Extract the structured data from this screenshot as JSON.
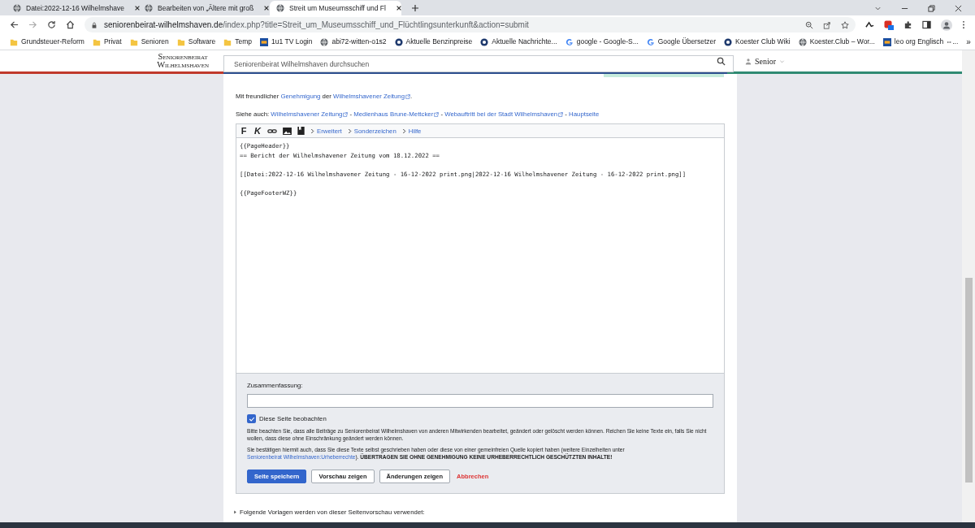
{
  "browser": {
    "tabs": [
      {
        "title": "Datei:2022-12-16 Wilhelmshave",
        "selected": false
      },
      {
        "title": "Bearbeiten von „Ältere mit groß",
        "selected": false
      },
      {
        "title": "Streit um Museumsschiff und Fl",
        "selected": true
      }
    ],
    "address": {
      "host": "seniorenbeirat-wilhelmshaven.de",
      "path": "/index.php?title=Streit_um_Museumsschiff_und_Flüchtlingsunterkunft&action=submit"
    },
    "bookmarks": [
      {
        "label": "Grundsteuer-Reform",
        "kind": "folder"
      },
      {
        "label": "Privat",
        "kind": "folder"
      },
      {
        "label": "Senioren",
        "kind": "folder"
      },
      {
        "label": "Software",
        "kind": "folder"
      },
      {
        "label": "Temp",
        "kind": "folder"
      },
      {
        "label": "1u1 TV Login",
        "kind": "badge"
      },
      {
        "label": "abi72-witten-o1s2",
        "kind": "globe"
      },
      {
        "label": "Aktuelle Benzinpreise",
        "kind": "site"
      },
      {
        "label": "Aktuelle Nachrichte...",
        "kind": "site"
      },
      {
        "label": "google - Google-S...",
        "kind": "google"
      },
      {
        "label": "Google Übersetzer",
        "kind": "google"
      },
      {
        "label": "Koester Club Wiki",
        "kind": "site"
      },
      {
        "label": "Koester.Club – Wor...",
        "kind": "globe"
      },
      {
        "label": "leo org  Englisch ⇔...",
        "kind": "badge"
      }
    ],
    "more": "»"
  },
  "site": {
    "logo_lines": [
      "Seniorenbeirat",
      "Wilhelmshaven"
    ],
    "search_placeholder": "Seniorenbeirat Wilhelmshaven durchsuchen",
    "user": "Senior"
  },
  "content": {
    "credit": [
      {
        "kind": "text",
        "text": "Mit freundlicher "
      },
      {
        "kind": "link",
        "text": "Genehmigung",
        "external": false
      },
      {
        "kind": "text",
        "text": " der "
      },
      {
        "kind": "link",
        "text": "Wilhelmshavener Zeitung",
        "external": true
      },
      {
        "kind": "text",
        "text": "."
      }
    ],
    "see_also": [
      {
        "kind": "text",
        "text": "Siehe auch: "
      },
      {
        "kind": "link",
        "text": "Wilhelmshavener Zeitung",
        "external": true
      },
      {
        "kind": "text",
        "text": " - "
      },
      {
        "kind": "link",
        "text": "Medienhaus Brune-Mettcker",
        "external": true
      },
      {
        "kind": "text",
        "text": " - "
      },
      {
        "kind": "link",
        "text": "Webauftritt bei der Stadt Wilhelmshaven",
        "external": true
      },
      {
        "kind": "text",
        "text": " - "
      },
      {
        "kind": "link",
        "text": "Hauptseite",
        "external": false
      }
    ],
    "toolbar": {
      "tools": [
        {
          "kind": "bold",
          "glyph": "F"
        },
        {
          "kind": "italic",
          "glyph": "K"
        },
        {
          "kind": "link"
        },
        {
          "kind": "image"
        },
        {
          "kind": "reference"
        }
      ],
      "sections": [
        "Erweitert",
        "Sonderzeichen",
        "Hilfe"
      ]
    },
    "wikitext": [
      [
        "{{PageHeader}}",
        "== Bericht der Wilhelmshavener Zeitung vom 18.12.2022 =="
      ],
      [
        "[[Datei:2022-12-16 Wilhelmshavener Zeitung - 16-12-2022 print.png|2022-12-16 Wilhelmshavener Zeitung - 16-12-2022 print.png]]"
      ],
      [
        "{{PageFooterWZ}}"
      ]
    ],
    "summary_label": "Zusammenfassung:",
    "watch": {
      "label": "Diese Seite beobachten",
      "checked": true
    },
    "notice": [
      [
        {
          "kind": "text",
          "text": "Bitte beachten Sie, dass alle Beiträge zu Seniorenbeirat Wilhelmshaven von anderen Mitwirkenden bearbeitet, geändert oder gelöscht werden können. Reichen Sie keine Texte ein, falls Sie nicht wollen, dass diese ohne Einschränkung geändert werden können."
        }
      ],
      [
        {
          "kind": "text",
          "text": "Sie bestätigen hiermit auch, dass Sie diese Texte selbst geschrieben haben oder diese von einer gemeinfreien Quelle kopiert haben (weitere Einzelheiten unter "
        },
        {
          "kind": "link",
          "text": "Seniorenbeirat Wilhelmshaven:Urheberrechte",
          "external": false
        },
        {
          "kind": "text",
          "text": "). **ÜBERTRAGEN SIE OHNE GENEHMIGUNG KEINE URHEBERRECHTLICH GESCHÜTZTEN INHALTE!**"
        }
      ]
    ],
    "actions": [
      {
        "label": "Seite speichern",
        "kind": "primary"
      },
      {
        "label": "Vorschau zeigen",
        "kind": "secondary"
      },
      {
        "label": "Änderungen zeigen",
        "kind": "secondary"
      },
      {
        "label": "Abbrechen",
        "kind": "destructive"
      }
    ],
    "templates_toggle": "Folgende Vorlagen werden von dieser Seitenvorschau verwendet:"
  }
}
